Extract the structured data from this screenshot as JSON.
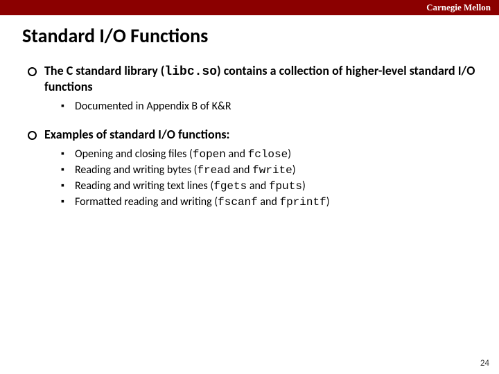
{
  "header": {
    "institution": "Carnegie Mellon"
  },
  "title": "Standard I/O Functions",
  "bullets": [
    {
      "line": {
        "pre": "The C standard library (",
        "code": "libc.so",
        "post": ") contains a collection of higher-level standard I/O functions"
      },
      "sub": [
        {
          "pre": "Documented in Appendix B of K&R"
        }
      ]
    },
    {
      "line": {
        "pre": "Examples of standard I/O functions:"
      },
      "sub": [
        {
          "pre": "Opening and closing files (",
          "code1": "fopen",
          "mid": " and ",
          "code2": "fclose",
          "post": ")"
        },
        {
          "pre": "Reading and writing bytes (",
          "code1": "fread",
          "mid": " and ",
          "code2": "fwrite",
          "post": ")"
        },
        {
          "pre": "Reading and writing text lines (",
          "code1": "fgets",
          "mid": " and ",
          "code2": "fputs",
          "post": ")"
        },
        {
          "pre": "Formatted reading and writing (",
          "code1": "fscanf",
          "mid": " and ",
          "code2": "fprintf",
          "post": ")"
        }
      ]
    }
  ],
  "page_number": "24"
}
